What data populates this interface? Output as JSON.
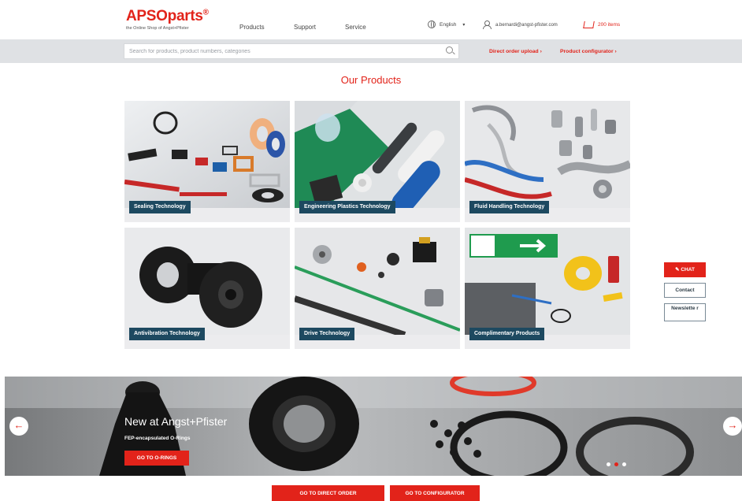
{
  "header": {
    "logo": "APSOparts",
    "logo_mark": "®",
    "tagline": "the Online Shop of Angst+Pfister",
    "nav": [
      "Products",
      "Support",
      "Service"
    ],
    "language": "English",
    "user_email": "a.bernardi@angst-pfister.com",
    "cart_label": "200 items"
  },
  "search": {
    "placeholder": "Search for products, product numbers, categories",
    "direct_order": "Direct order upload ›",
    "configurator": "Product configurator ›"
  },
  "main": {
    "title": "Our Products",
    "tiles": [
      {
        "label": "Sealing Technology"
      },
      {
        "label": "Engineering Plastics Technology"
      },
      {
        "label": "Fluid Handling Technology"
      },
      {
        "label": "Antivibration Technology"
      },
      {
        "label": "Drive Technology"
      },
      {
        "label": "Complimentary Products"
      }
    ]
  },
  "side": {
    "chat": "CHAT",
    "contact": "Contact",
    "newsletter": "Newslette r"
  },
  "hero": {
    "title": "New at Angst+Pfister",
    "subtitle": "FEP-encapsulated O-Rings",
    "button": "GO TO O-RINGS",
    "active_slide": 2,
    "slide_count": 3
  },
  "bottom": {
    "direct_order": "GO TO DIRECT ORDER",
    "configurator": "GO TO CONFIGURATOR"
  },
  "colors": {
    "brand_red": "#e2231a",
    "label_bg": "#1d4960",
    "search_bar": "#dfe1e4"
  }
}
